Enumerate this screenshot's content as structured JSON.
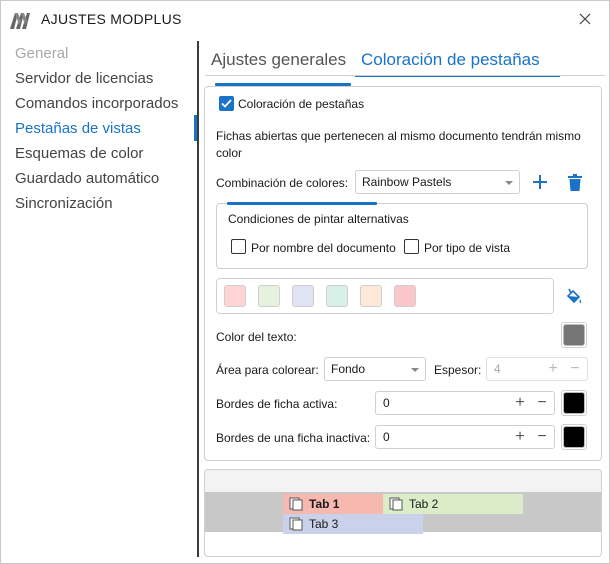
{
  "window": {
    "title": "AJUSTES MODPLUS"
  },
  "sidebar": {
    "items": [
      {
        "label": "General",
        "state": "disabled"
      },
      {
        "label": "Servidor de licencias",
        "state": "normal"
      },
      {
        "label": "Comandos incorporados",
        "state": "normal"
      },
      {
        "label": "Pestañas de vistas",
        "state": "active"
      },
      {
        "label": "Esquemas de color",
        "state": "normal"
      },
      {
        "label": "Guardado automático",
        "state": "normal"
      },
      {
        "label": "Sincronización",
        "state": "normal"
      }
    ]
  },
  "tabs": {
    "general": "Ajustes generales",
    "coloring": "Coloración de pestañas",
    "active": "coloring"
  },
  "settings": {
    "enable_label": "Coloración de pestañas",
    "enable_checked": true,
    "description": "Fichas abiertas que pertenecen al mismo documento tendrán mismo color",
    "scheme_label": "Combinación de colores:",
    "scheme_value": "Rainbow Pastels",
    "alt_group_title": "Condiciones de pintar alternativas",
    "by_document_label": "Por nombre del documento",
    "by_document_checked": false,
    "by_view_label": "Por tipo de vista",
    "by_view_checked": false,
    "palette": [
      "#fdd5d5",
      "#e6f3dc",
      "#dfe3f3",
      "#d8f0e6",
      "#fde8d9",
      "#fbc6c9"
    ],
    "text_color_label": "Color del texto:",
    "text_color": "#757575",
    "area_label": "Área para colorear:",
    "area_value": "Fondo",
    "thickness_label": "Espesor:",
    "thickness_value": "4",
    "active_border_label": "Bordes de ficha activa:",
    "active_border_value": "0",
    "active_border_color": "#000000",
    "inactive_border_label": "Bordes de una ficha inactiva:",
    "inactive_border_value": "0",
    "inactive_border_color": "#000000"
  },
  "preview": {
    "tabs": [
      {
        "label": "Tab 1",
        "bold": true,
        "color": "#f7b8b0"
      },
      {
        "label": "Tab 2",
        "bold": false,
        "color": "#dcebc8"
      },
      {
        "label": "Tab 3",
        "bold": false,
        "color": "#c9d2ea"
      }
    ]
  },
  "colors": {
    "accent": "#1a73c8",
    "delete": "#1a73c8"
  },
  "icons": {
    "app": "modplus-logo",
    "close": "close-icon",
    "add": "plus-icon",
    "delete": "trash-icon",
    "fill": "paint-bucket-icon",
    "doc": "document-icon"
  }
}
